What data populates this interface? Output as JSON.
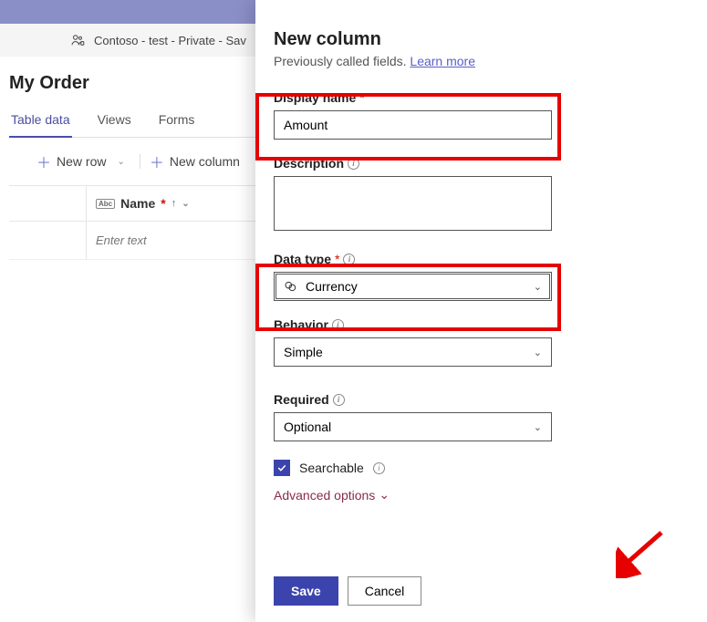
{
  "breadcrumb": {
    "text": "Contoso - test - Private - Sav"
  },
  "page": {
    "title": "My Order"
  },
  "tabs": {
    "items": [
      {
        "label": "Table data",
        "active": true
      },
      {
        "label": "Views",
        "active": false
      },
      {
        "label": "Forms",
        "active": false
      }
    ]
  },
  "toolbar": {
    "new_row": "New row",
    "new_column": "New column"
  },
  "grid": {
    "name_header": "Name",
    "input_placeholder": "Enter text"
  },
  "panel": {
    "title": "New column",
    "subtitle_prefix": "Previously called fields. ",
    "learn_more": "Learn more",
    "display_name": {
      "label": "Display name",
      "value": "Amount"
    },
    "description": {
      "label": "Description",
      "value": ""
    },
    "data_type": {
      "label": "Data type",
      "value": "Currency"
    },
    "behavior": {
      "label": "Behavior",
      "value": "Simple"
    },
    "required": {
      "label": "Required",
      "value": "Optional"
    },
    "searchable": {
      "label": "Searchable",
      "checked": true
    },
    "advanced_options": "Advanced options",
    "save": "Save",
    "cancel": "Cancel"
  }
}
